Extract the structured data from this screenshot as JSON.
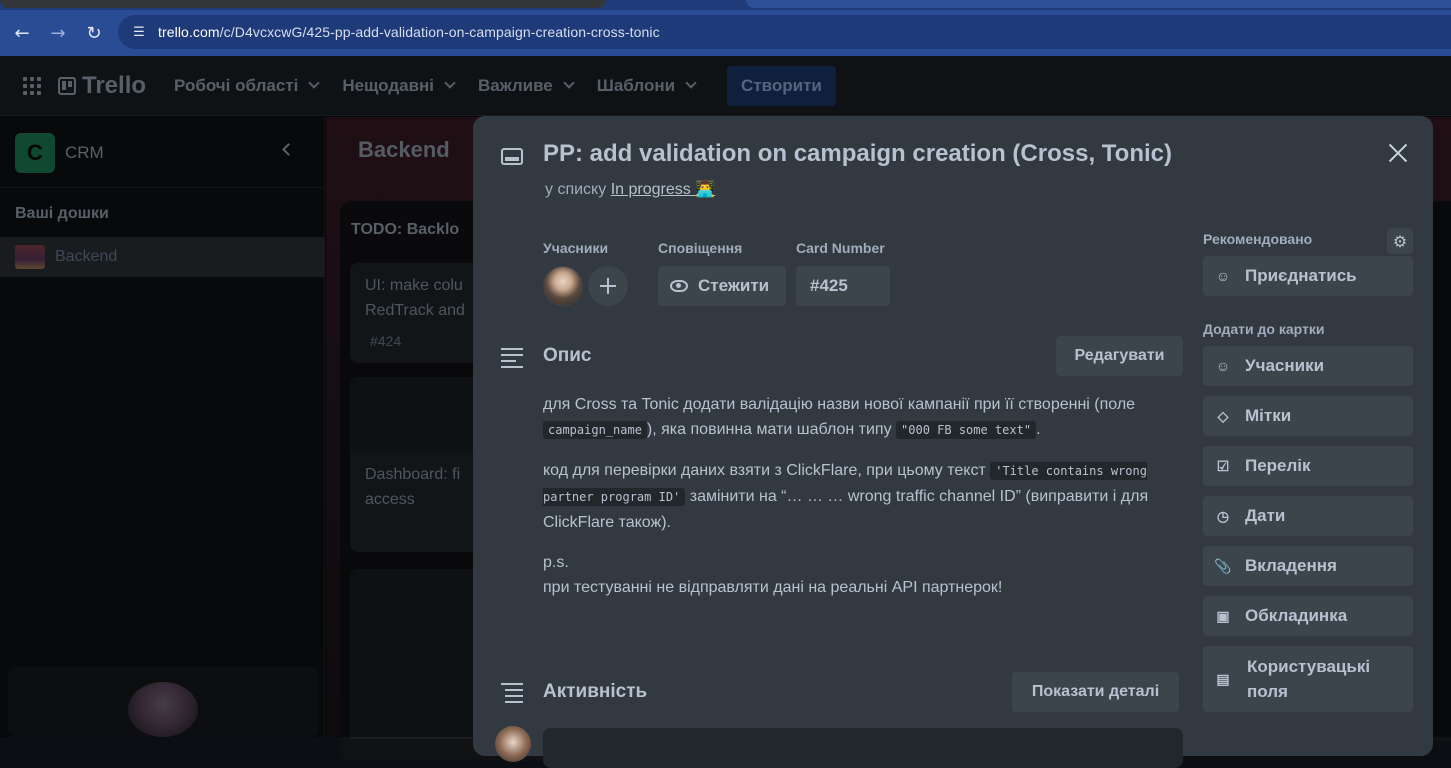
{
  "browser": {
    "url_domain": "trello.com",
    "url_path": "/c/D4vcxcwG/425-pp-add-validation-on-campaign-creation-cross-tonic",
    "back_icon": "arrow-left-icon",
    "forward_icon": "arrow-right-icon",
    "reload_icon": "reload-icon"
  },
  "header": {
    "logo": "Trello",
    "menus": [
      "Робочі області",
      "Нещодавні",
      "Важливе",
      "Шаблони"
    ],
    "create_label": "Створити"
  },
  "sidebar": {
    "workspace_letter": "C",
    "workspace_name": "CRM",
    "boards_title": "Ваші дошки",
    "boards": [
      "Backend"
    ]
  },
  "board": {
    "title": "Backend",
    "list_title": "TODO: Backlo",
    "cards": [
      {
        "text_line1": "UI: make colu",
        "text_line2": "RedTrack and",
        "number": "#424"
      },
      {
        "text_line1": "Dashboard: fi",
        "text_line2": "access"
      }
    ]
  },
  "card": {
    "title": "PP: add validation on campaign creation (Cross, Tonic)",
    "in_list_prefix": "у списку",
    "list_name": "In progress 👨‍💻",
    "members_label": "Учасники",
    "notifications_label": "Сповіщення",
    "watch_label": "Стежити",
    "card_number_label": "Card Number",
    "card_number_value": "#425",
    "description_title": "Опис",
    "edit_label": "Редагувати",
    "description": {
      "p1_a": "для Cross та Tonic додати валідацію назви нової кампанії при її створенні (поле ",
      "p1_code1": "campaign_name",
      "p1_b": "), яка повинна мати шаблон типу ",
      "p1_code2": "\"000 FB some text\"",
      "p1_c": ".",
      "p2_a": "код для перевірки даних взяти з ClickFlare, при цьому текст ",
      "p2_code": "'Title contains wrong partner program ID'",
      "p2_b": " замінити на “… … … wrong traffic channel ID” (виправити і для ClickFlare також).",
      "p3_line1": "p.s.",
      "p3_line2": "при тестуванні не відправляти дані на реальні API партнерок!"
    },
    "activity_title": "Активність",
    "show_details_label": "Показати деталі"
  },
  "right_panel": {
    "recommended_title": "Рекомендовано",
    "join_label": "Приєднатись",
    "add_to_card_title": "Додати до картки",
    "buttons": [
      {
        "label": "Учасники",
        "icon": "person-icon"
      },
      {
        "label": "Мітки",
        "icon": "tag-icon"
      },
      {
        "label": "Перелік",
        "icon": "checklist-icon"
      },
      {
        "label": "Дати",
        "icon": "clock-icon"
      },
      {
        "label": "Вкладення",
        "icon": "paperclip-icon"
      },
      {
        "label": "Обкладинка",
        "icon": "cover-icon"
      },
      {
        "label": "Користувацькі поля",
        "icon": "custom-fields-icon"
      }
    ]
  }
}
